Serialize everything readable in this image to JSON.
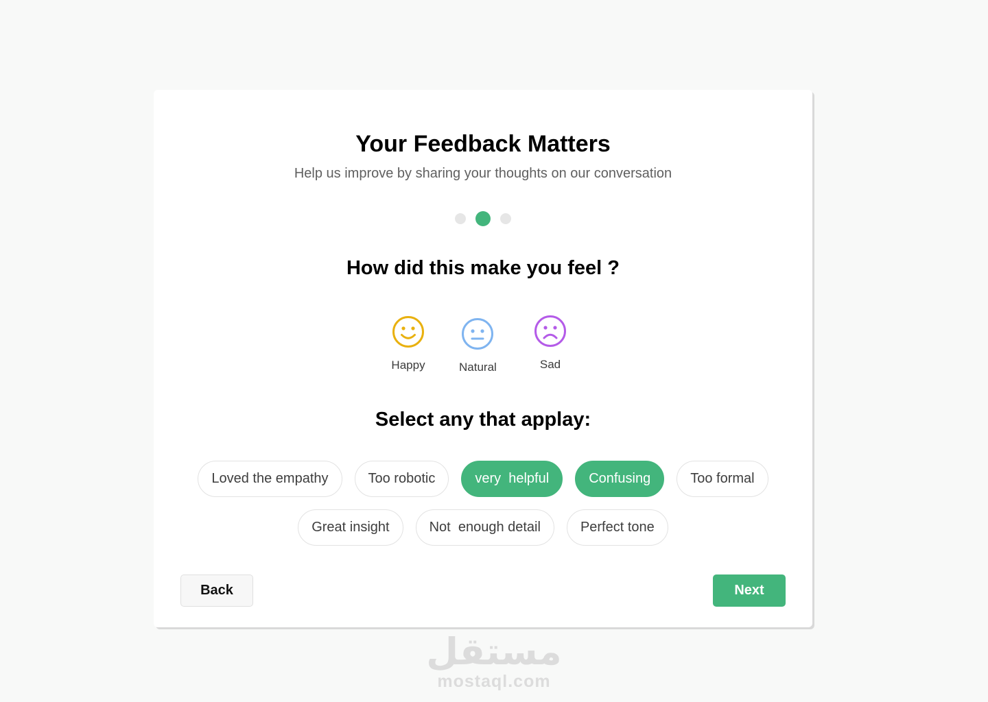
{
  "header": {
    "title": "Your Feedback Matters",
    "subtitle": "Help us improve by sharing your thoughts on our conversation"
  },
  "progress": {
    "total_steps": 3,
    "current_step": 2
  },
  "feeling": {
    "question": "How did this make you feel ?",
    "options": [
      {
        "label": "Happy",
        "icon": "smile-icon",
        "color": "#e9b10f"
      },
      {
        "label": "Natural",
        "icon": "neutral-face-icon",
        "color": "#7fb4f0"
      },
      {
        "label": "Sad",
        "icon": "frown-icon",
        "color": "#b45be8"
      }
    ]
  },
  "tags": {
    "title": "Select any that applay:",
    "items": [
      {
        "label": "Loved the empathy",
        "selected": false
      },
      {
        "label": "Too robotic",
        "selected": false
      },
      {
        "label": "very  helpful",
        "selected": true
      },
      {
        "label": "Confusing",
        "selected": true
      },
      {
        "label": "Too formal",
        "selected": false
      },
      {
        "label": "Great insight",
        "selected": false
      },
      {
        "label": "Not  enough detail",
        "selected": false
      },
      {
        "label": "Perfect tone",
        "selected": false
      }
    ]
  },
  "actions": {
    "back_label": "Back",
    "next_label": "Next"
  },
  "watermark": {
    "arabic": "مستقل",
    "latin": "mostaql.com"
  },
  "colors": {
    "accent": "#43b57c",
    "background": "#f8f9f8",
    "card": "#ffffff"
  }
}
